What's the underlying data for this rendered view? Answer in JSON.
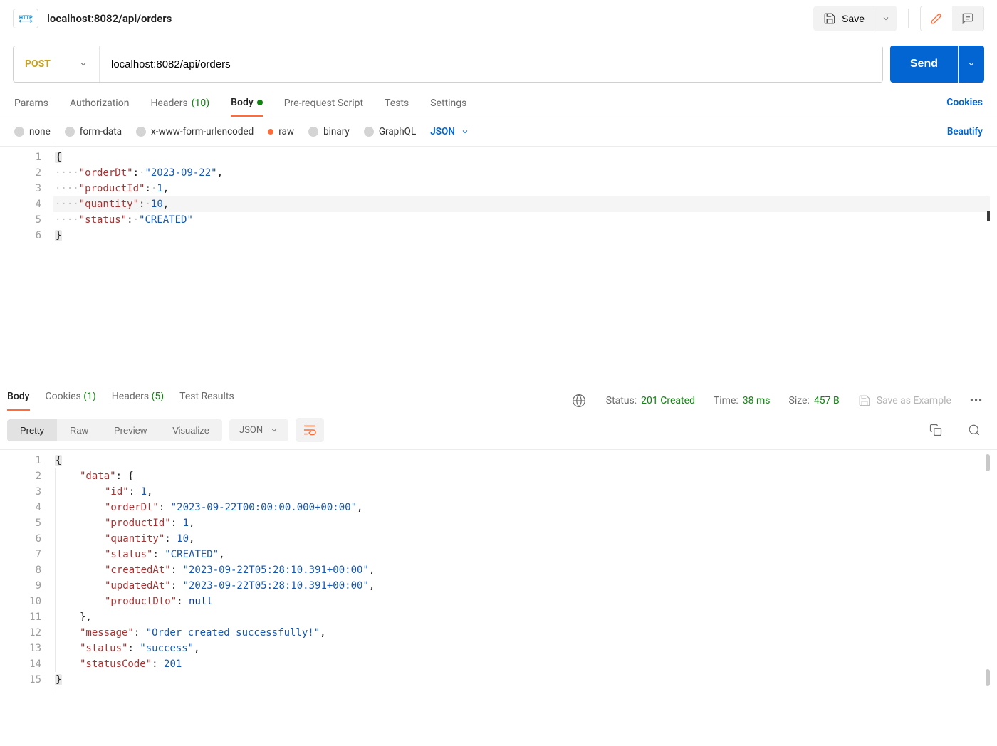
{
  "header": {
    "tab_title": "localhost:8082/api/orders",
    "save_label": "Save"
  },
  "request": {
    "method": "POST",
    "url": "localhost:8082/api/orders",
    "send_label": "Send"
  },
  "tabs": {
    "params": "Params",
    "authorization": "Authorization",
    "headers_label": "Headers",
    "headers_count": "(10)",
    "body": "Body",
    "prerequest": "Pre-request Script",
    "tests": "Tests",
    "settings": "Settings",
    "cookies": "Cookies"
  },
  "body_types": {
    "none": "none",
    "form_data": "form-data",
    "xwww": "x-www-form-urlencoded",
    "raw": "raw",
    "binary": "binary",
    "graphql": "GraphQL",
    "lang": "JSON",
    "beautify": "Beautify"
  },
  "request_body": {
    "orderDt": "2023-09-22",
    "productId": 1,
    "quantity": 10,
    "status": "CREATED"
  },
  "response_header": {
    "body": "Body",
    "cookies_label": "Cookies",
    "cookies_count": "(1)",
    "headers_label": "Headers",
    "headers_count": "(5)",
    "test_results": "Test Results",
    "status_label": "Status:",
    "status_val": "201 Created",
    "time_label": "Time:",
    "time_val": "38 ms",
    "size_label": "Size:",
    "size_val": "457 B",
    "save_example": "Save as Example"
  },
  "response_view": {
    "pretty": "Pretty",
    "raw": "Raw",
    "preview": "Preview",
    "visualize": "Visualize",
    "lang": "JSON"
  },
  "response_body": {
    "data": {
      "id": 1,
      "orderDt": "2023-09-22T00:00:00.000+00:00",
      "productId": 1,
      "quantity": 10,
      "status": "CREATED",
      "createdAt": "2023-09-22T05:28:10.391+00:00",
      "updatedAt": "2023-09-22T05:28:10.391+00:00",
      "productDto": null
    },
    "message": "Order created successfully!",
    "status": "success",
    "statusCode": 201
  }
}
